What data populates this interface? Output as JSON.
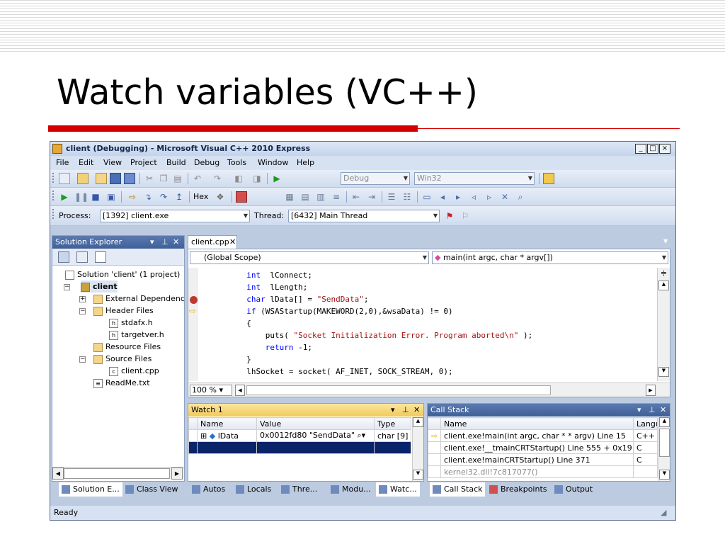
{
  "slide": {
    "title": "Watch variables (VC++)"
  },
  "window": {
    "title": "client (Debugging) - Microsoft Visual C++ 2010 Express",
    "minimize": "_",
    "maximize": "□",
    "close": "×"
  },
  "menu": [
    "File",
    "Edit",
    "View",
    "Project",
    "Build",
    "Debug",
    "Tools",
    "Window",
    "Help"
  ],
  "toolbar": {
    "config": "Debug",
    "platform": "Win32",
    "hex_label": "Hex"
  },
  "debug_location": {
    "process_label": "Process:",
    "process_value": "[1392] client.exe",
    "thread_label": "Thread:",
    "thread_value": "[6432] Main Thread"
  },
  "solution_explorer": {
    "title": "Solution Explorer",
    "tree": {
      "solution": "Solution 'client' (1 project)",
      "project": "client",
      "external": "External Dependenc",
      "header_files": "Header Files",
      "stdafx": "stdafx.h",
      "targetver": "targetver.h",
      "resource_files": "Resource Files",
      "source_files": "Source Files",
      "client_cpp": "client.cpp",
      "readme": "ReadMe.txt"
    }
  },
  "editor": {
    "tab": "client.cpp",
    "scope": "(Global Scope)",
    "function": "main(int argc, char * argv[])",
    "zoom": "100 %",
    "lines": [
      {
        "kw": "int",
        "rest": "  lConnect;",
        "indent": "          "
      },
      {
        "kw": "int",
        "rest": "  lLength;",
        "indent": "          "
      },
      {
        "kw": "char",
        "rest": " lData[] = ",
        "str": "\"SendData\"",
        "tail": ";",
        "indent": "          "
      },
      {
        "kw": "if",
        "rest": " (WSAStartup(MAKEWORD(2,0),&wsaData) != 0)",
        "indent": "          "
      },
      {
        "kw": "",
        "rest": "{",
        "indent": "          "
      },
      {
        "kw": "",
        "rest": "puts( ",
        "str": "\"Socket Initialization Error. Program aborted\\n\"",
        "tail": " );",
        "indent": "              "
      },
      {
        "kw": "return",
        "rest": " -1;",
        "indent": "              "
      },
      {
        "kw": "",
        "rest": "}",
        "indent": "          "
      },
      {
        "kw": "",
        "rest": "lhSocket = socket( AF_INET, SOCK_STREAM, 0);",
        "indent": "          "
      }
    ]
  },
  "watch": {
    "title": "Watch 1",
    "headers": {
      "name": "Name",
      "value": "Value",
      "type": "Type"
    },
    "row": {
      "name": "lData",
      "value": "0x0012fd80 \"SendData\"",
      "type": "char [9]"
    }
  },
  "call_stack": {
    "title": "Call Stack",
    "headers": {
      "name": "Name",
      "lang": "Langu"
    },
    "rows": [
      {
        "name": "client.exe!main(int argc, char * * argv)  Line 15",
        "lang": "C++"
      },
      {
        "name": "client.exe!__tmainCRTStartup()  Line 555 + 0x19",
        "lang": "C"
      },
      {
        "name": "client.exe!mainCRTStartup()  Line 371",
        "lang": "C"
      },
      {
        "name": "kernel32.dll!7c817077()",
        "lang": ""
      }
    ]
  },
  "bottom_tabs_left": [
    "Solution E...",
    "Class View"
  ],
  "bottom_tabs_mid": [
    "Autos",
    "Locals",
    "Thre...",
    "Modu...",
    "Watc..."
  ],
  "bottom_tabs_right": [
    "Call Stack",
    "Breakpoints",
    "Output"
  ],
  "status": "Ready",
  "colors": {
    "accent_red": "#d40000",
    "vs_chrome": "#bccbe0",
    "active_header": "#f2c95a",
    "selection": "#0a246a"
  }
}
